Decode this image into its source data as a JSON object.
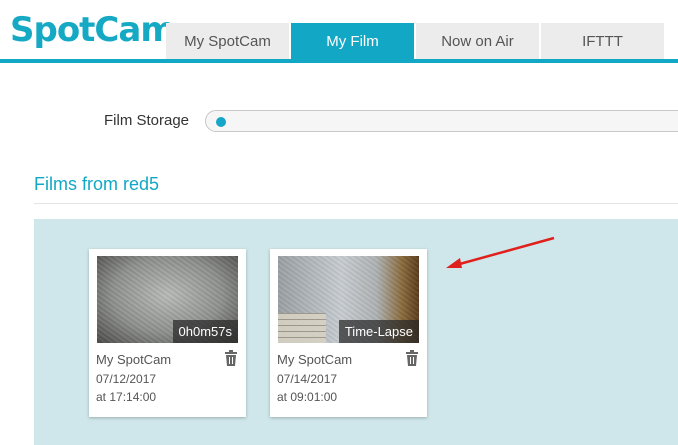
{
  "brand": {
    "logo_text": "SpotCam",
    "accent_color": "#12a7c4"
  },
  "nav": {
    "tabs": [
      {
        "label": "My SpotCam",
        "active": false
      },
      {
        "label": "My Film",
        "active": true
      },
      {
        "label": "Now on Air",
        "active": false
      },
      {
        "label": "IFTTT",
        "active": false
      }
    ]
  },
  "storage": {
    "label": "Film Storage",
    "used_fraction": 0.02
  },
  "section": {
    "title": "Films from red5"
  },
  "films": [
    {
      "camera": "My SpotCam",
      "date": "07/12/2017",
      "time": "at 17:14:00",
      "badge": "0h0m57s",
      "delete_icon": "trash-icon"
    },
    {
      "camera": "My SpotCam",
      "date": "07/14/2017",
      "time": "at 09:01:00",
      "badge": "Time-Lapse",
      "delete_icon": "trash-icon"
    }
  ],
  "annotation": {
    "type": "arrow",
    "color": "#e0201c"
  }
}
